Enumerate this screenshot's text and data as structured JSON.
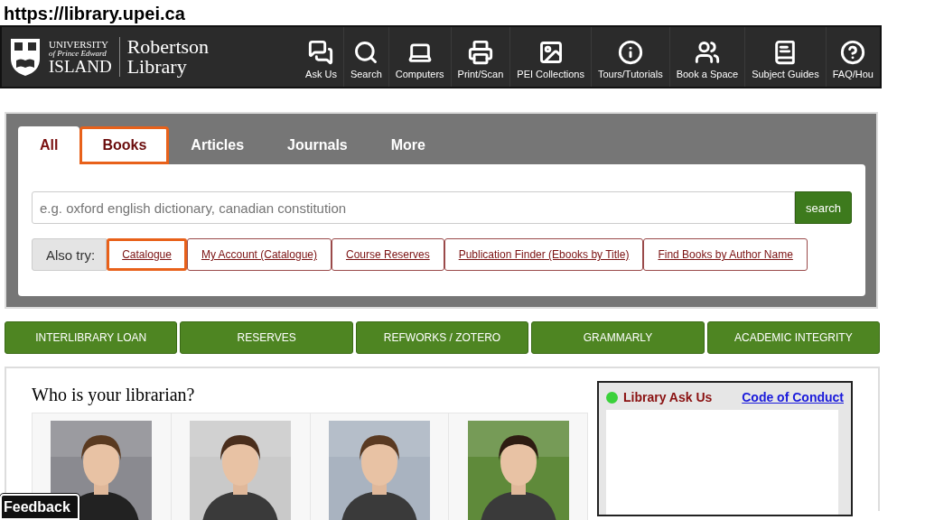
{
  "url": "https://library.upei.ca",
  "header": {
    "logo": {
      "line1": "UNIVERSITY",
      "line2": "of Prince Edward",
      "line3": "ISLAND"
    },
    "library": [
      "Robertson",
      "Library"
    ],
    "nav": [
      "Ask Us",
      "Search",
      "Computers",
      "Print/Scan",
      "PEI Collections",
      "Tours/Tutorials",
      "Book a Space",
      "Subject Guides",
      "FAQ/Hou"
    ]
  },
  "search": {
    "tabs": [
      {
        "label": "All",
        "selected": true,
        "highlighted": false
      },
      {
        "label": "Books",
        "selected": false,
        "highlighted": true
      },
      {
        "label": "Articles",
        "selected": false,
        "highlighted": false
      },
      {
        "label": "Journals",
        "selected": false,
        "highlighted": false
      },
      {
        "label": "More",
        "selected": false,
        "highlighted": false
      }
    ],
    "placeholder": "e.g. oxford english dictionary, canadian constitution",
    "button": "search",
    "also_try": "Also try:",
    "links": [
      {
        "label": "Catalogue",
        "highlighted": true
      },
      {
        "label": "My Account (Catalogue)",
        "highlighted": false
      },
      {
        "label": "Course Reserves",
        "highlighted": false
      },
      {
        "label": "Publication Finder (Ebooks by Title)",
        "highlighted": false
      },
      {
        "label": "Find Books by Author Name",
        "highlighted": false
      }
    ]
  },
  "quick_links": [
    "INTERLIBRARY LOAN",
    "RESERVES",
    "REFWORKS / ZOTERO",
    "GRAMMARLY",
    "ACADEMIC INTEGRITY"
  ],
  "librarians": {
    "title": "Who is your librarian?"
  },
  "chat": {
    "title": "Library Ask Us",
    "online": true,
    "link": "Code of Conduct"
  },
  "feedback": "Feedback"
}
